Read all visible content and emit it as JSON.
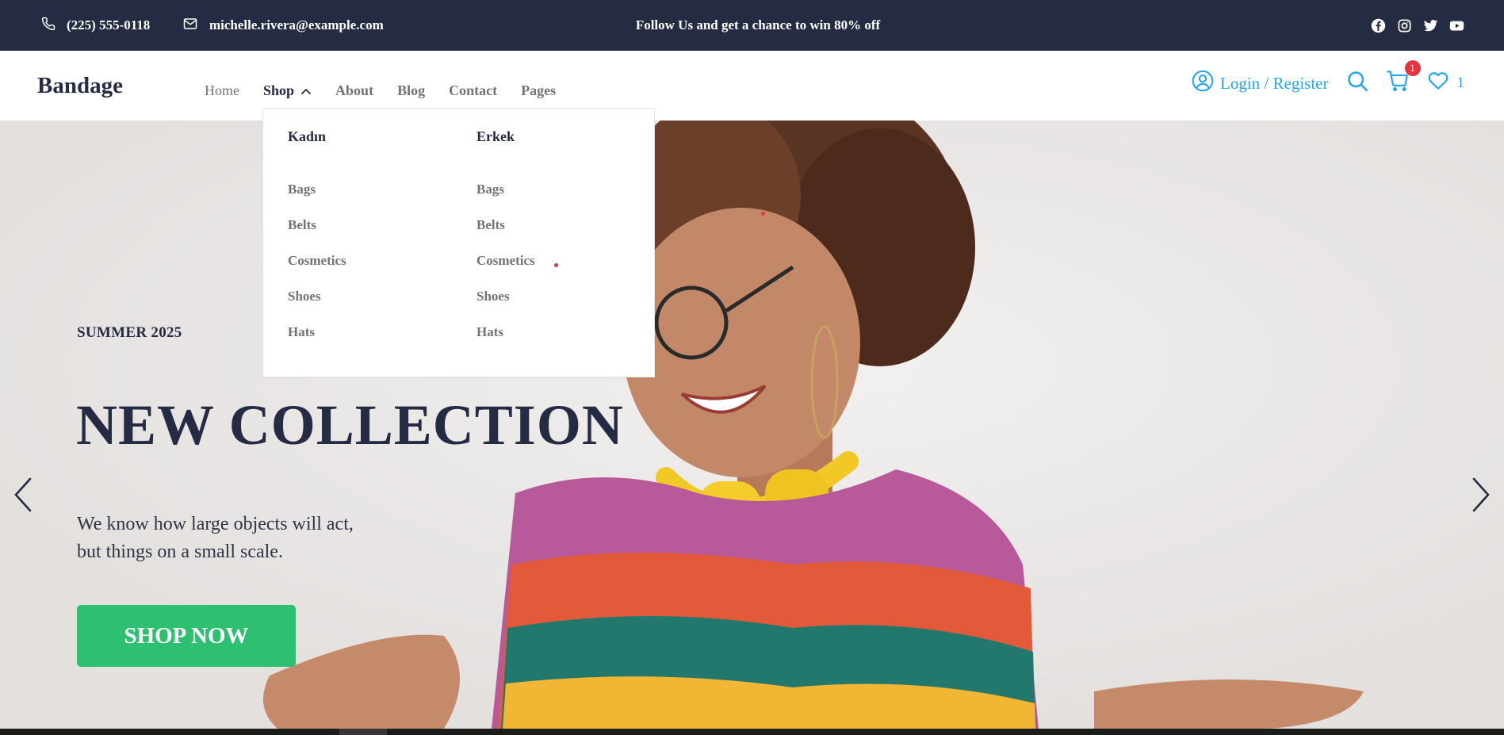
{
  "topbar": {
    "phone": "(225) 555-0118",
    "email": "michelle.rivera@example.com",
    "promo": "Follow Us  and get a chance to win 80% off",
    "socials": [
      "facebook-icon",
      "instagram-icon",
      "twitter-icon",
      "youtube-icon"
    ]
  },
  "header": {
    "brand": "Bandage",
    "nav": {
      "home": "Home",
      "shop": "Shop",
      "about": "About",
      "blog": "Blog",
      "contact": "Contact",
      "pages": "Pages"
    },
    "login": "Login / Register",
    "cart_count": "1",
    "wishlist_count": "1"
  },
  "dropdown": {
    "columns": [
      {
        "title": "Kadın",
        "items": [
          "Bags",
          "Belts",
          "Cosmetics",
          "Shoes",
          "Hats"
        ]
      },
      {
        "title": "Erkek",
        "items": [
          "Bags",
          "Belts",
          "Cosmetics",
          "Shoes",
          "Hats"
        ]
      }
    ]
  },
  "hero": {
    "eyebrow": "SUMMER 2025",
    "headline": "NEW COLLECTION",
    "desc_line1": "We know how large objects will act,",
    "desc_line2": "but things on a small scale.",
    "cta": "SHOP NOW"
  },
  "colors": {
    "dark": "#252b42",
    "accent_blue": "#23a6f0",
    "success_green": "#2dc071",
    "badge_red": "#e5343f",
    "muted": "#737373"
  }
}
